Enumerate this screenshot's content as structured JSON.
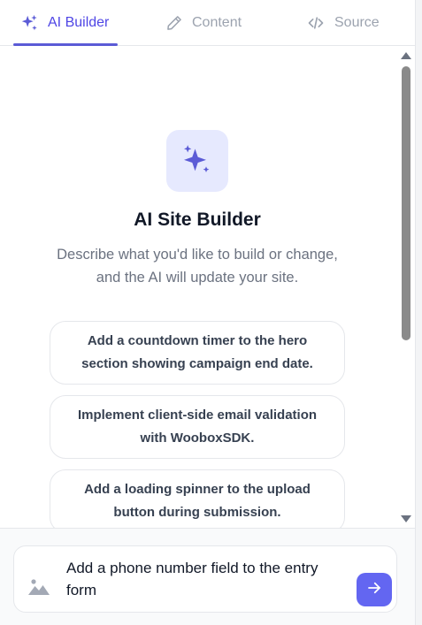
{
  "tabs": [
    {
      "label": "AI Builder",
      "icon": "sparkles-icon",
      "active": true
    },
    {
      "label": "Content",
      "icon": "pencil-icon",
      "active": false
    },
    {
      "label": "Source",
      "icon": "code-icon",
      "active": false
    }
  ],
  "main": {
    "title": "AI Site Builder",
    "subtitle": "Describe what you'd like to build or change, and the AI will update your site.",
    "suggestions": [
      "Add a countdown timer to the hero section showing campaign end date.",
      "Implement client-side email validation with WooboxSDK.",
      "Add a loading spinner to the upload button during submission."
    ]
  },
  "composer": {
    "value": "Add a phone number field to the entry form",
    "image_icon": "image-icon",
    "send_icon": "arrow-right-icon"
  },
  "colors": {
    "accent": "#5b5bd6",
    "send_button": "#6366f1",
    "hero_icon_bg": "#e6e9fe",
    "muted_text": "#9ca3af"
  }
}
